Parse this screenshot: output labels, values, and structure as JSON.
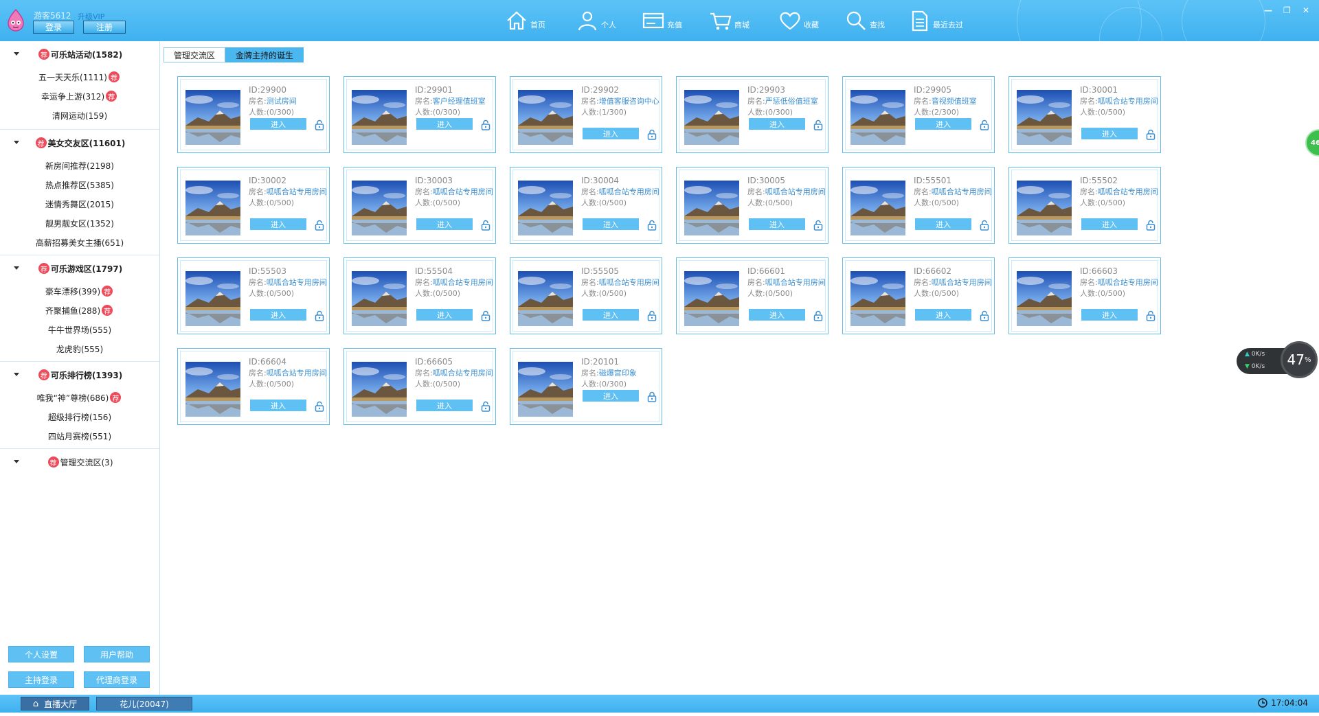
{
  "header": {
    "username": "游客5612",
    "vip_label": "升级VIP",
    "login_label": "登录",
    "register_label": "注册",
    "nav": [
      {
        "label": "首页",
        "icon": "home-icon"
      },
      {
        "label": "个人",
        "icon": "user-icon"
      },
      {
        "label": "充值",
        "icon": "recharge-icon"
      },
      {
        "label": "商城",
        "icon": "cart-icon"
      },
      {
        "label": "收藏",
        "icon": "heart-icon"
      },
      {
        "label": "查找",
        "icon": "search-icon"
      },
      {
        "label": "最近去过",
        "icon": "document-icon"
      }
    ],
    "window_controls": [
      "—",
      "❐",
      "✕"
    ]
  },
  "sidebar": {
    "badge": "荐",
    "groups": [
      {
        "title": "可乐站活动(1582)",
        "items": [
          {
            "label": "五一天天乐(1111)",
            "badge": true
          },
          {
            "label": "幸运争上游(312)",
            "badge": true
          },
          {
            "label": "清网运动(159)",
            "badge": false
          }
        ]
      },
      {
        "title": "美女交友区(11601)",
        "items": [
          {
            "label": "新房间推荐(2198)",
            "badge": false
          },
          {
            "label": "热点推荐区(5385)",
            "badge": false
          },
          {
            "label": "迷情秀舞区(2015)",
            "badge": false
          },
          {
            "label": "靓男靓女区(1352)",
            "badge": false
          },
          {
            "label": "高薪招募美女主播(651)",
            "badge": false
          }
        ]
      },
      {
        "title": "可乐游戏区(1797)",
        "items": [
          {
            "label": "豪车漂移(399)",
            "badge": true
          },
          {
            "label": "齐聚捕鱼(288)",
            "badge": true
          },
          {
            "label": "牛牛世界场(555)",
            "badge": false
          },
          {
            "label": "龙虎豹(555)",
            "badge": false
          }
        ]
      },
      {
        "title": "可乐排行榜(1393)",
        "items": [
          {
            "label": "唯我“神”尊榜(686)",
            "badge": true
          },
          {
            "label": "超级排行榜(156)",
            "badge": false
          },
          {
            "label": "四站月赛榜(551)",
            "badge": false
          }
        ]
      },
      {
        "title": "管理交流区(3)",
        "items": []
      }
    ],
    "buttons": {
      "personal_settings": "个人设置",
      "user_help": "用户帮助",
      "host_login": "主持登录",
      "agent_login": "代理商登录"
    }
  },
  "tabs": [
    {
      "label": "管理交流区",
      "active": false
    },
    {
      "label": "金牌主持的诞生",
      "active": true
    }
  ],
  "room_labels": {
    "id_prefix": "ID:",
    "name_prefix": "房名:",
    "count_prefix": "人数:",
    "enter": "进入"
  },
  "rooms": [
    {
      "id": "29900",
      "name": "测试房间",
      "count": "(0/300)"
    },
    {
      "id": "29901",
      "name": "客户经理值班室",
      "count": "(0/300)"
    },
    {
      "id": "29902",
      "name": "增值客服咨询中心",
      "count": "(1/300)"
    },
    {
      "id": "29903",
      "name": "严惩低俗值班室",
      "count": "(0/300)"
    },
    {
      "id": "29905",
      "name": "音视频值班室",
      "count": "(2/300)"
    },
    {
      "id": "30001",
      "name": "呱呱合站专用房间",
      "count": "(0/500)"
    },
    {
      "id": "30002",
      "name": "呱呱合站专用房间",
      "count": "(0/500)"
    },
    {
      "id": "30003",
      "name": "呱呱合站专用房间",
      "count": "(0/500)"
    },
    {
      "id": "30004",
      "name": "呱呱合站专用房间",
      "count": "(0/500)"
    },
    {
      "id": "30005",
      "name": "呱呱合站专用房间",
      "count": "(0/500)"
    },
    {
      "id": "55501",
      "name": "呱呱合站专用房间",
      "count": "(0/500)"
    },
    {
      "id": "55502",
      "name": "呱呱合站专用房间",
      "count": "(0/500)"
    },
    {
      "id": "55503",
      "name": "呱呱合站专用房间",
      "count": "(0/500)"
    },
    {
      "id": "55504",
      "name": "呱呱合站专用房间",
      "count": "(0/500)"
    },
    {
      "id": "55505",
      "name": "呱呱合站专用房间",
      "count": "(0/500)"
    },
    {
      "id": "66601",
      "name": "呱呱合站专用房间",
      "count": "(0/500)"
    },
    {
      "id": "66602",
      "name": "呱呱合站专用房间",
      "count": "(0/500)"
    },
    {
      "id": "66603",
      "name": "呱呱合站专用房间",
      "count": "(0/500)"
    },
    {
      "id": "66604",
      "name": "呱呱合站专用房间",
      "count": "(0/500)"
    },
    {
      "id": "66605",
      "name": "呱呱合站专用房间",
      "count": "(0/500)"
    },
    {
      "id": "20101",
      "name": "磁爆宫印象",
      "count": "(0/300)"
    }
  ],
  "statusbar": {
    "lobby_label": "直播大厅",
    "room_tab": "花儿(20047)",
    "time": "17:04:04"
  },
  "widgets": {
    "edge_ball": "46",
    "speed_up": "0K/s",
    "speed_down": "0K/s",
    "percent": "47",
    "percent_unit": "%"
  },
  "colors": {
    "accent": "#4ab7f1",
    "badge": "#ee4a5a",
    "link": "#3b8fd0"
  }
}
